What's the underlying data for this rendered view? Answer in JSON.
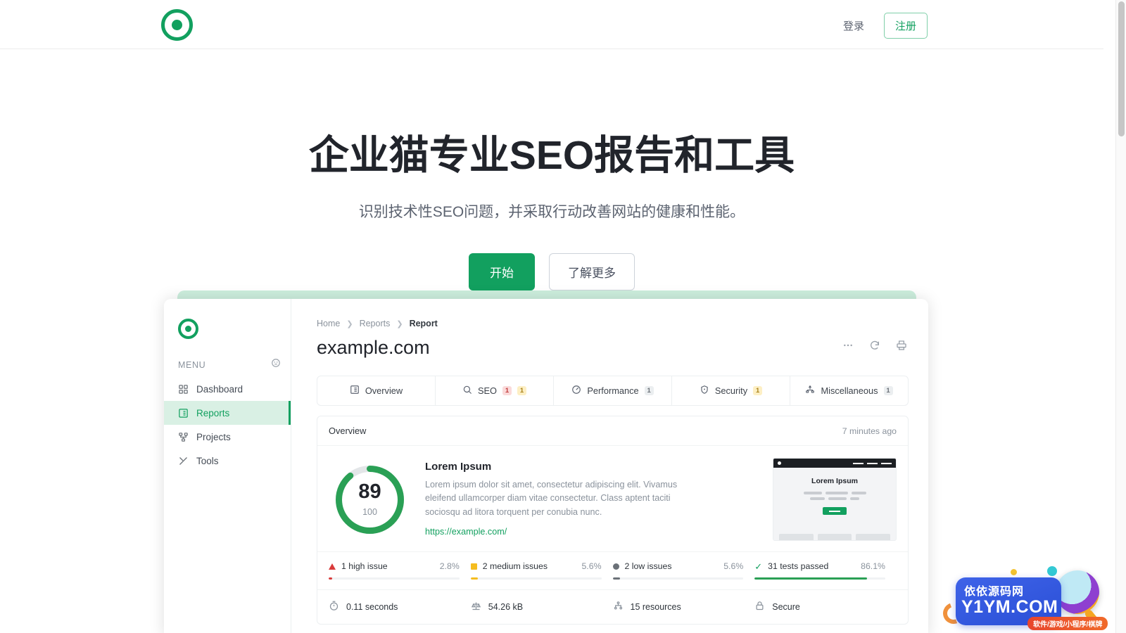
{
  "header": {
    "logo_icon": "target-logo-icon",
    "login_label": "登录",
    "register_label": "注册"
  },
  "hero": {
    "title": "企业猫专业SEO报告和工具",
    "subtitle": "识别技术性SEO问题，并采取行动改善网站的健康和性能。",
    "primary_cta": "开始",
    "secondary_cta": "了解更多"
  },
  "app": {
    "sidebar": {
      "logo_icon": "target-logo-icon",
      "menu_label": "MENU",
      "menu_action_icon": "user-circle-icon",
      "items": [
        {
          "label": "Dashboard",
          "icon": "grid-icon",
          "active": false
        },
        {
          "label": "Reports",
          "icon": "report-list-icon",
          "active": true
        },
        {
          "label": "Projects",
          "icon": "project-node-icon",
          "active": false
        },
        {
          "label": "Tools",
          "icon": "tools-icon",
          "active": false
        }
      ]
    },
    "breadcrumb": [
      "Home",
      "Reports",
      "Report"
    ],
    "title": "example.com",
    "title_actions": [
      {
        "icon": "ellipsis-icon"
      },
      {
        "icon": "refresh-icon"
      },
      {
        "icon": "print-icon"
      }
    ],
    "tabs": [
      {
        "label": "Overview",
        "icon": "list-detail-icon",
        "badges": []
      },
      {
        "label": "SEO",
        "icon": "search-icon",
        "badges": [
          {
            "value": "1",
            "level": "red"
          },
          {
            "value": "1",
            "level": "yellow"
          }
        ]
      },
      {
        "label": "Performance",
        "icon": "gauge-icon",
        "badges": [
          {
            "value": "1",
            "level": "grey"
          }
        ]
      },
      {
        "label": "Security",
        "icon": "shield-icon",
        "badges": [
          {
            "value": "1",
            "level": "yellow"
          }
        ]
      },
      {
        "label": "Miscellaneous",
        "icon": "sitemap-icon",
        "badges": [
          {
            "value": "1",
            "level": "grey"
          }
        ]
      }
    ],
    "panel": {
      "title": "Overview",
      "timestamp": "7 minutes ago",
      "score": "89",
      "score_max": "100",
      "score_percent": 89,
      "score_color": "#2aa055",
      "heading": "Lorem Ipsum",
      "paragraph": "Lorem ipsum dolor sit amet, consectetur adipiscing elit. Vivamus eleifend ullamcorper diam vitae consectetur. Class aptent taciti sociosqu ad litora torquent per conubia nunc.",
      "url": "https://example.com/",
      "thumbnail": {
        "heading": "Lorem Ipsum",
        "button_icon": "placeholder-button"
      },
      "stats": [
        {
          "label": "1 high issue",
          "percent": "2.8%",
          "fill": 2.8,
          "marker": "triangle",
          "color": "#d93b3b"
        },
        {
          "label": "2 medium issues",
          "percent": "5.6%",
          "fill": 5.6,
          "marker": "square",
          "color": "#f5bd1f"
        },
        {
          "label": "2 low issues",
          "percent": "5.6%",
          "fill": 5.6,
          "marker": "circle",
          "color": "#6b7178"
        },
        {
          "label": "31 tests passed",
          "percent": "86.1%",
          "fill": 86.1,
          "marker": "check",
          "color": "#2aa055"
        }
      ],
      "metrics": [
        {
          "label": "0.11 seconds",
          "icon": "timer-icon"
        },
        {
          "label": "54.26 kB",
          "icon": "scale-icon"
        },
        {
          "label": "15 resources",
          "icon": "sitemap-icon"
        },
        {
          "label": "Secure",
          "icon": "lock-icon"
        }
      ]
    }
  },
  "watermark": {
    "cn": "依依源码网",
    "en": "Y1YM.COM",
    "tag": "软件/游戏/小程序/棋牌"
  }
}
